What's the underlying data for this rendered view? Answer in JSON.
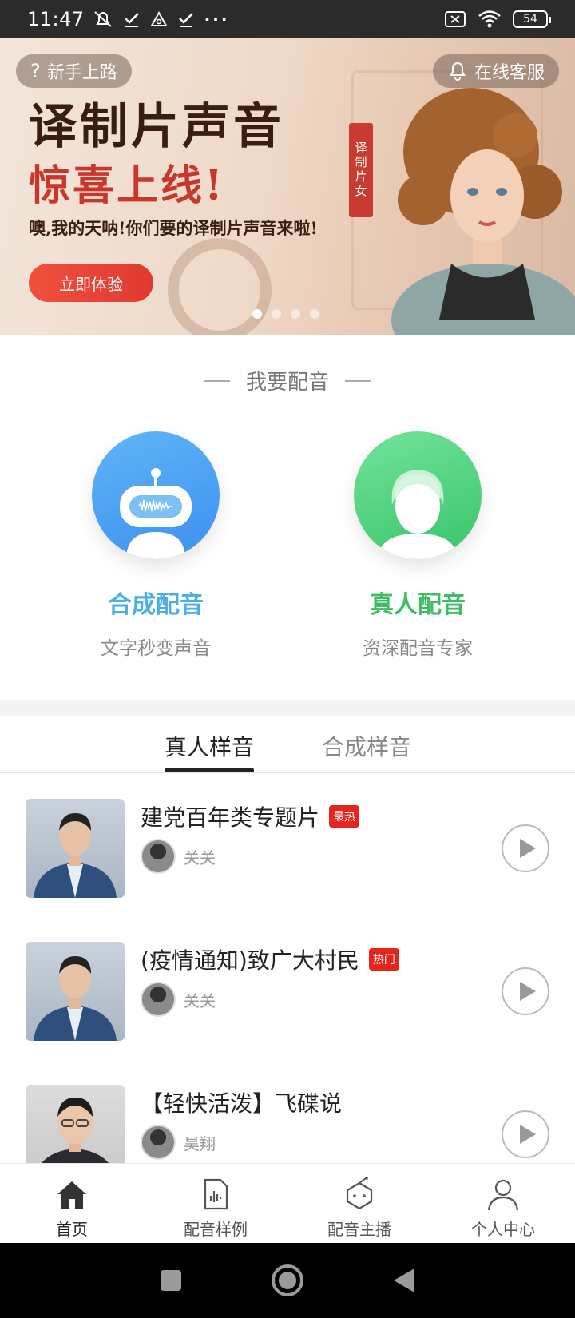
{
  "status_bar": {
    "time": "11:47",
    "left_icons": [
      "mute-bell-icon",
      "check-icon",
      "warning-icon",
      "check-icon",
      "more-icon"
    ],
    "battery": "54"
  },
  "banner": {
    "help_label": "新手上路",
    "cs_label": "在线客服",
    "title_line1": "译制片声音",
    "title_line2": "惊喜上线!",
    "subtitle": "噢,我的天呐!你们要的译制片声音来啦!",
    "tag": "译制片女",
    "cta": "立即体验",
    "dots": 4,
    "active_dot": 0
  },
  "dubbing": {
    "section_title": "我要配音",
    "options": [
      {
        "title": "合成配音",
        "subtitle": "文字秒变声音",
        "icon": "robot-icon",
        "color": "#4aaee8"
      },
      {
        "title": "真人配音",
        "subtitle": "资深配音专家",
        "icon": "person-icon",
        "color": "#3dbe63"
      }
    ]
  },
  "tabs": [
    {
      "label": "真人样音",
      "active": true
    },
    {
      "label": "合成样音",
      "active": false
    }
  ],
  "samples": [
    {
      "title": "建党百年类专题片",
      "badge": "最热",
      "author": "关关"
    },
    {
      "title": "(疫情通知)致广大村民",
      "badge": "热门",
      "author": "关关"
    },
    {
      "title": "【轻快活泼】飞碟说",
      "badge": "",
      "author": "昊翔"
    }
  ],
  "bottom_nav": [
    {
      "label": "首页",
      "icon": "home-icon",
      "active": true
    },
    {
      "label": "配音样例",
      "icon": "audio-file-icon",
      "active": false
    },
    {
      "label": "配音主播",
      "icon": "anchor-icon",
      "active": false
    },
    {
      "label": "个人中心",
      "icon": "user-icon",
      "active": false
    }
  ]
}
